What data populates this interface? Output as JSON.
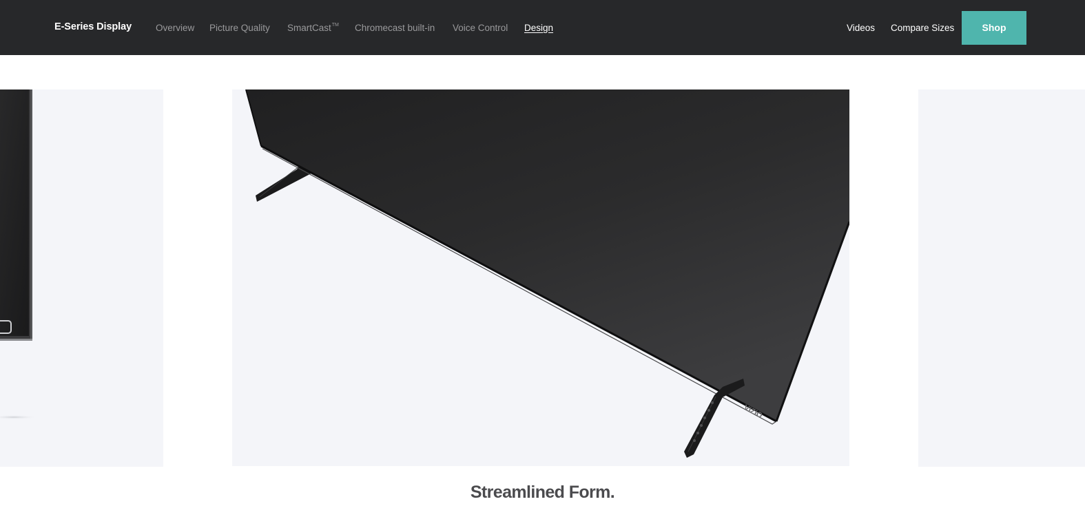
{
  "header": {
    "brand": "E-Series Display",
    "nav": [
      {
        "label": "Overview",
        "active": false
      },
      {
        "label": "Picture Quality",
        "active": false
      },
      {
        "label": "SmartCast",
        "sup": "TM",
        "active": false
      },
      {
        "label": "Chromecast built-in",
        "active": false
      },
      {
        "label": "Voice Control",
        "active": false
      },
      {
        "label": "Design",
        "active": true
      }
    ],
    "right_links": {
      "videos": "Videos",
      "compare_sizes": "Compare Sizes"
    },
    "shop_label": "Shop"
  },
  "carousel": {
    "current_slide": {
      "image_description": "TV angled from below, showing stand legs"
    },
    "headline": "Streamlined Form."
  },
  "colors": {
    "nav_background": "#27282a",
    "accent": "#4fb5ad",
    "slide_background": "#f4f5f9",
    "headline_text": "#4b4b4e"
  }
}
